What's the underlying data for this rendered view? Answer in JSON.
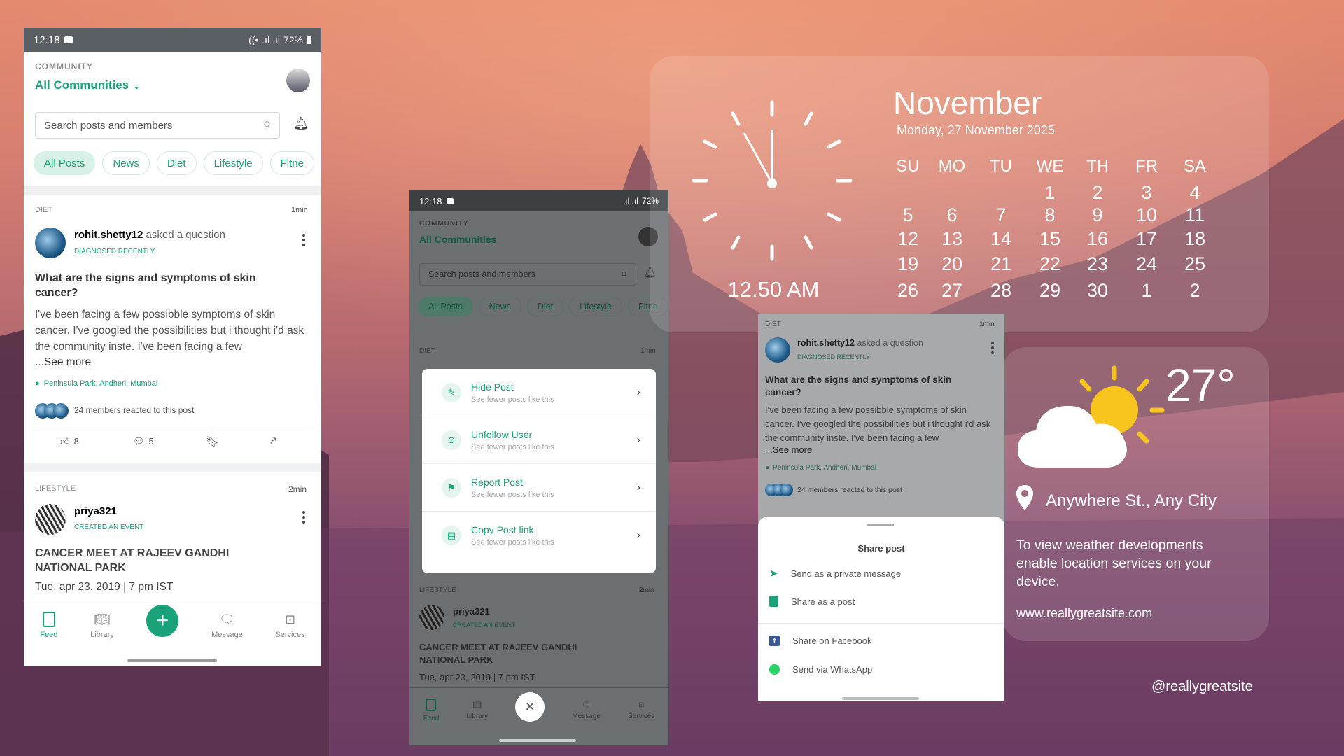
{
  "colors": {
    "accent": "#1aa37a",
    "statusbar": "#5a5f63"
  },
  "phone1": {
    "status": {
      "time": "12:18",
      "battery": "72%"
    },
    "community_label": "COMMUNITY",
    "community_select": "All Communities",
    "search_placeholder": "Search posts and members",
    "chips": [
      "All Posts",
      "News",
      "Diet",
      "Lifestyle",
      "Fitne"
    ],
    "post1": {
      "category": "DIET",
      "time": "1min",
      "user": "rohit.shetty12",
      "action": "asked a question",
      "badge": "DIAGNOSED RECENTLY",
      "title": "What are the signs and symptoms of skin cancer?",
      "body": "I've been facing a few possibble symptoms of skin cancer. I've googled the possibilities but i thought i'd ask the community inste. I've been facing a few",
      "see_more": "...See more",
      "location": "Peninsula Park, Andheri, Mumbai",
      "reactions": "24 members reacted to this post",
      "likes": "8",
      "comments": "5"
    },
    "post2": {
      "category": "LIFESTYLE",
      "time": "2min",
      "user": "priya321",
      "badge": "CREATED AN EVENT",
      "title": "CANCER MEET AT RAJEEV GANDHI NATIONAL PARK",
      "date": "Tue, apr 23, 2019 | 7 pm IST"
    },
    "nav": [
      "Feed",
      "Library",
      "Message",
      "Services"
    ]
  },
  "phone2": {
    "status": {
      "time": "12:18",
      "battery": "72%"
    },
    "community_label": "COMMUNITY",
    "community_select": "All Communities",
    "search_placeholder": "Search posts and members",
    "chips": [
      "All Posts",
      "News",
      "Diet",
      "Lifestyle",
      "Fitne"
    ],
    "post1": {
      "category": "DIET",
      "time": "1min",
      "user": "rohit.shetty12",
      "action": "asked a question"
    },
    "menu": [
      {
        "title": "Hide Post",
        "sub": "See fewer posts like this",
        "icon": "pencil-icon"
      },
      {
        "title": "Unfollow User",
        "sub": "See fewer posts like this",
        "icon": "unfollow-icon"
      },
      {
        "title": "Report Post",
        "sub": "See fewer posts like this",
        "icon": "report-icon"
      },
      {
        "title": "Copy Post link",
        "sub": "See fewer posts like this",
        "icon": "link-icon"
      }
    ],
    "post2": {
      "category": "LIFESTYLE",
      "time": "2min",
      "user": "priya321",
      "badge": "CREATED AN EVENT",
      "title": "CANCER MEET AT RAJEEV GANDHI NATIONAL PARK",
      "date": "Tue, apr 23, 2019 | 7 pm IST"
    },
    "nav": [
      "Feed",
      "Library",
      "Message",
      "Services"
    ]
  },
  "phone3": {
    "post": {
      "category": "DIET",
      "time": "1min",
      "user": "rohit.shetty12",
      "action": "asked a question",
      "badge": "DIAGNOSED RECENTLY",
      "title": "What are the signs and symptoms of skin cancer?",
      "body": "I've been facing a few possibble symptoms of skin cancer. I've googled the possibilities but i thought i'd ask the community inste. I've been facing a few",
      "see_more": "...See more",
      "location": "Peninsula Park, Andheri, Mumbai",
      "reactions": "24 members reacted to this post"
    },
    "share": {
      "title": "Share post",
      "options": [
        "Send as a private message",
        "Share as a post",
        "Share on Facebook",
        "Send via WhatsApp"
      ]
    }
  },
  "widget": {
    "clock_time": "12.50 AM",
    "month": "November",
    "date": "Monday, 27 November 2025",
    "weekdays": [
      "SU",
      "MO",
      "TU",
      "WE",
      "TH",
      "FR",
      "SA"
    ],
    "weeks": [
      [
        "",
        "",
        "",
        "1",
        "2",
        "3",
        "4"
      ],
      [
        "5",
        "6",
        "7",
        "8",
        "9",
        "10",
        "11"
      ],
      [
        "12",
        "13",
        "14",
        "15",
        "16",
        "17",
        "18"
      ],
      [
        "19",
        "20",
        "21",
        "22",
        "23",
        "24",
        "25"
      ],
      [
        "26",
        "27",
        "28",
        "29",
        "30",
        "1",
        "2"
      ]
    ],
    "temperature": "27°",
    "location": "Anywhere St., Any City",
    "note": "To view weather developments enable location services on your device.",
    "website": "www.reallygreatsite.com",
    "handle": "@reallygreatsite"
  }
}
